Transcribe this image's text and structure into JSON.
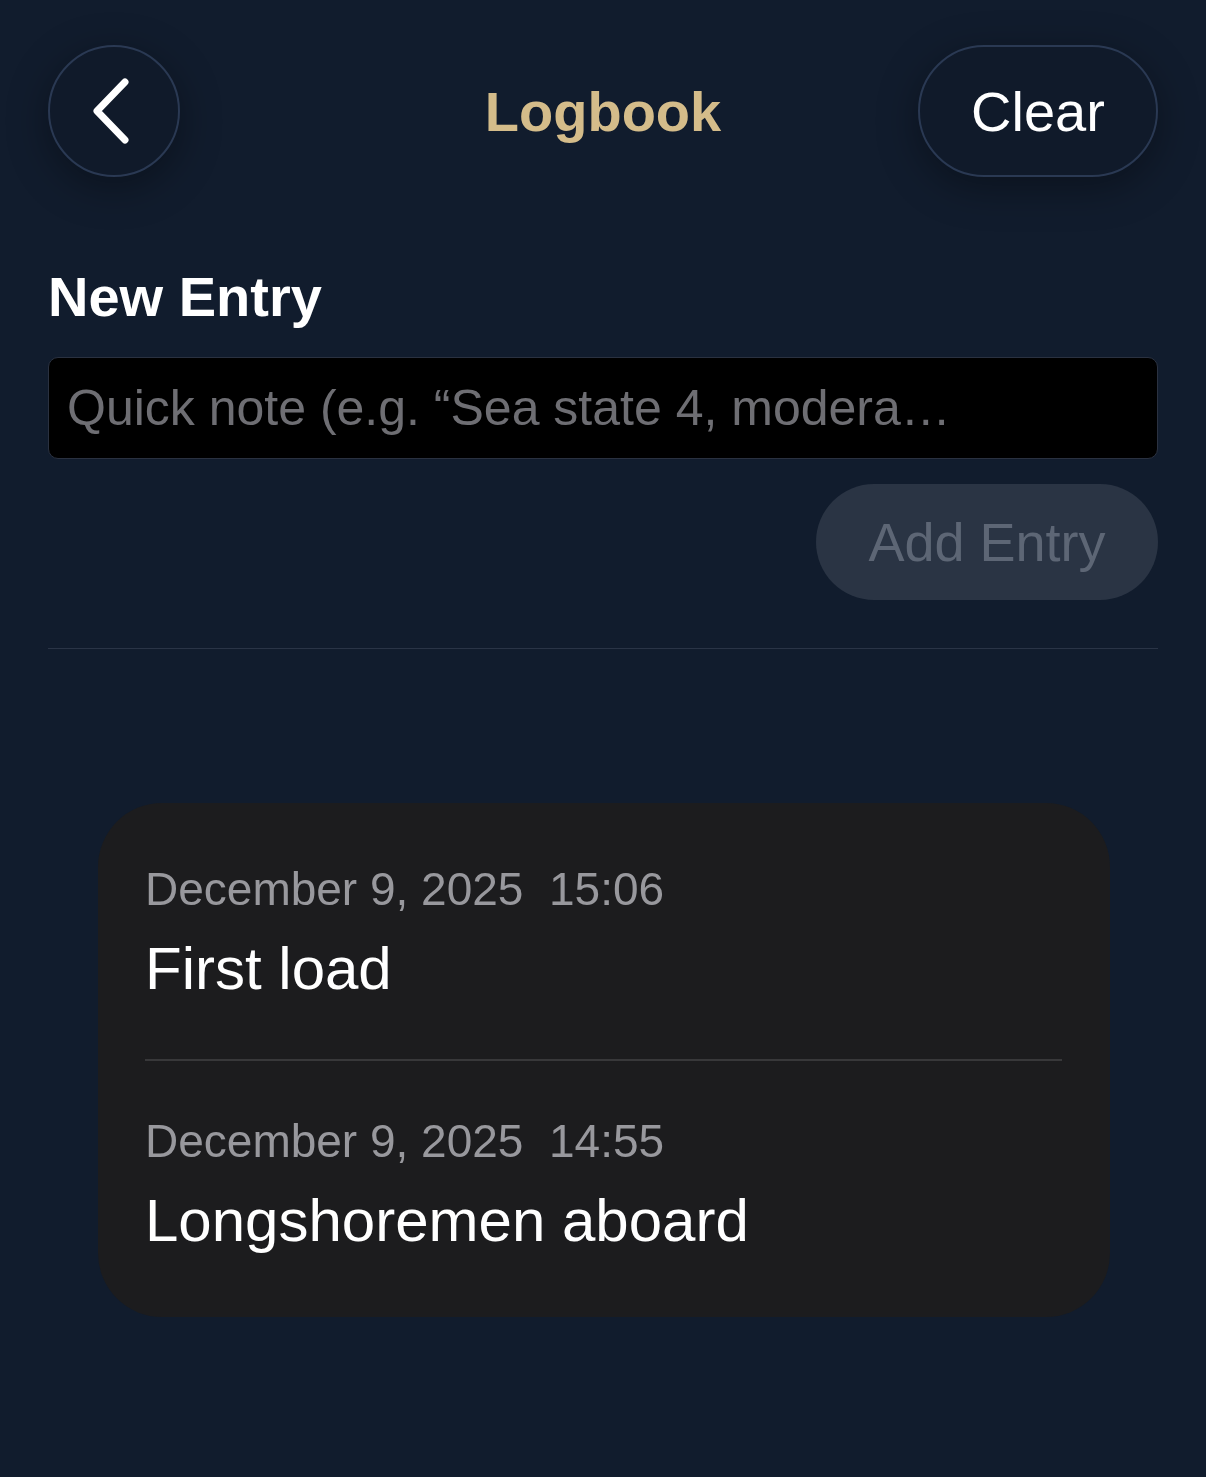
{
  "header": {
    "title": "Logbook",
    "clear_button": "Clear"
  },
  "new_entry": {
    "heading": "New Entry",
    "placeholder": "Quick note (e.g. “Sea state 4, modera…",
    "add_button": {
      "label": "Add Entry",
      "disabled": true
    }
  },
  "entries": [
    {
      "timestamp": "December 9, 2025  15:06",
      "note": "First load"
    },
    {
      "timestamp": "December 9, 2025  14:55",
      "note": "Longshoremen aboard"
    }
  ]
}
